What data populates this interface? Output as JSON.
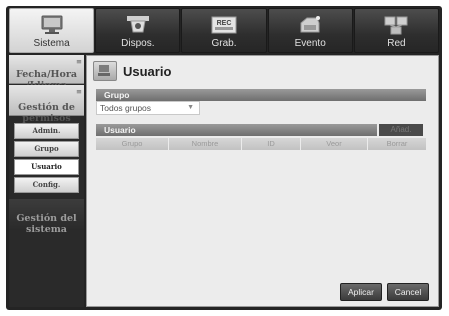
{
  "nav": {
    "tabs": [
      {
        "label": "Sistema",
        "icon": "monitor-icon",
        "active": true
      },
      {
        "label": "Dispos.",
        "icon": "camera-icon",
        "active": false
      },
      {
        "label": "Grab.",
        "icon": "recorder-icon",
        "active": false
      },
      {
        "label": "Evento",
        "icon": "event-icon",
        "active": false
      },
      {
        "label": "Red",
        "icon": "network-icon",
        "active": false
      }
    ],
    "rec_badge": "REC"
  },
  "sidebar": {
    "fecha_hora": "Fecha/Hora\n/Idioma",
    "gestion_permisos": "Gestión de\npermisos",
    "items": [
      {
        "label": "Admin."
      },
      {
        "label": "Grupo"
      },
      {
        "label": "Usuario"
      },
      {
        "label": "Config."
      }
    ],
    "gestion_sistema": "Gestión del\nsistema"
  },
  "main": {
    "title": "Usuario",
    "group_label": "Grupo",
    "group_value": "Todos grupos",
    "user_label": "Usuario",
    "add_label": "Añad.",
    "columns": [
      "Grupo",
      "Nombre",
      "ID",
      "Veor",
      "Borrar"
    ],
    "apply_label": "Aplicar",
    "cancel_label": "Cancel"
  }
}
